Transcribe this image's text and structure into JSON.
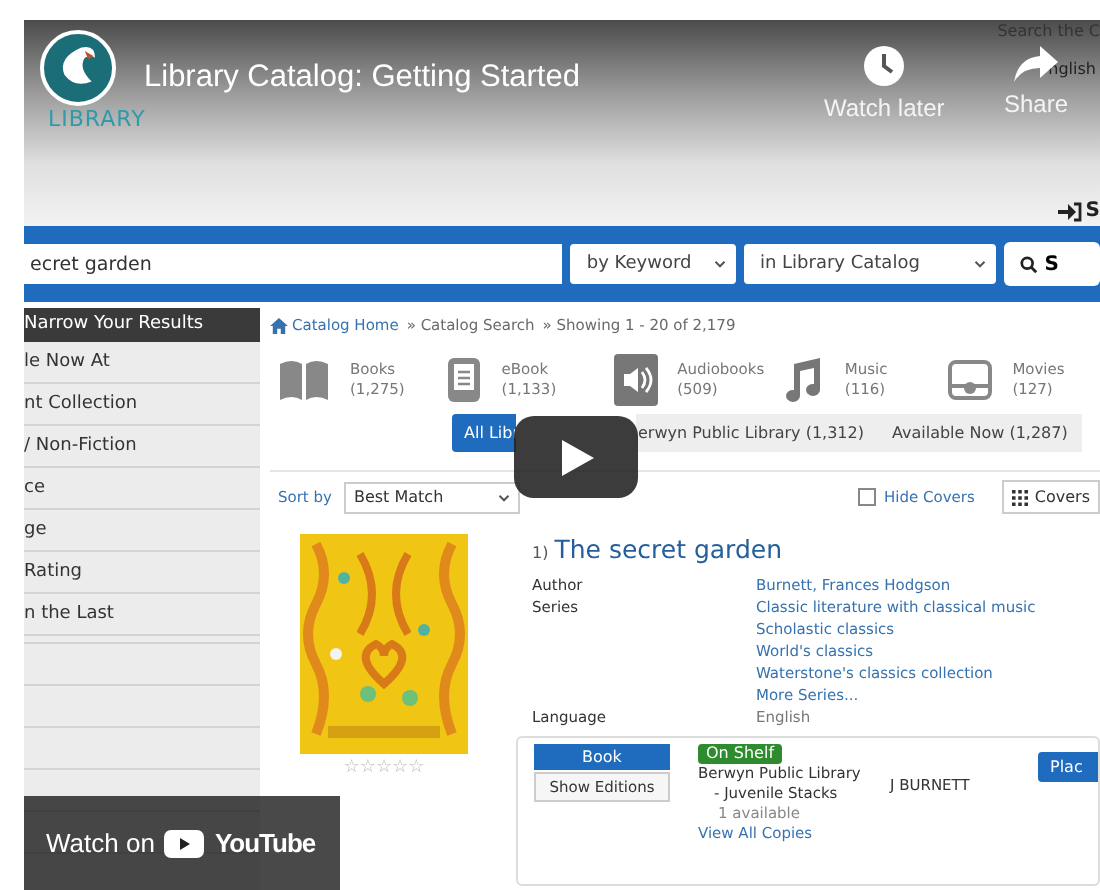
{
  "video": {
    "title": "Library Catalog: Getting Started",
    "actions": [
      {
        "kind": "clock",
        "label": "Watch later"
      },
      {
        "kind": "share",
        "label": "Share"
      }
    ],
    "watch_on": "Watch on",
    "brand": "YouTube"
  },
  "site": {
    "logo_text": "LIBRARY",
    "top_link": "Search the C",
    "language": "nglish",
    "sign_in": "S"
  },
  "search": {
    "value": "ecret garden",
    "type": "by Keyword",
    "scope": "in Library Catalog",
    "button": "S"
  },
  "sidebar": {
    "title": "Narrow Your Results",
    "items": [
      "le Now At",
      "nt Collection",
      "/ Non-Fiction",
      "ce",
      "ge",
      "Rating",
      "n the Last"
    ]
  },
  "breadcrumb": [
    "Catalog Home",
    "» Catalog Search",
    "» Showing 1 - 20 of 2,179"
  ],
  "formats": [
    {
      "kind": "book",
      "name": "Books",
      "count": "(1,275)"
    },
    {
      "kind": "ebook",
      "name": "eBook",
      "count": "(1,133)"
    },
    {
      "kind": "audio",
      "name": "Audiobooks",
      "count": "(509)"
    },
    {
      "kind": "music",
      "name": "Music",
      "count": "(116)"
    },
    {
      "kind": "movie",
      "name": "Movies",
      "count": "(127)"
    }
  ],
  "tabs": [
    {
      "label": "All Libr",
      "selected": true
    },
    {
      "label": "erwyn Public Library (1,312)",
      "selected": false
    },
    {
      "label": "Available Now (1,287)",
      "selected": false
    }
  ],
  "sort": {
    "label": "Sort by",
    "value": "Best Match"
  },
  "hide_covers": {
    "label": "Hide Covers",
    "checked": false
  },
  "view_button": "Covers",
  "result": {
    "number": "1)",
    "title": "The secret garden",
    "stars": 0,
    "details": [
      {
        "label": "Author",
        "link": true,
        "values": [
          "Burnett, Frances Hodgson"
        ]
      },
      {
        "label": "Series",
        "link": true,
        "values": [
          "Classic literature with classical music",
          "Scholastic classics",
          "World's classics",
          "Waterstone's classics collection",
          "More Series..."
        ]
      },
      {
        "label": "Language",
        "link": false,
        "values": [
          "English"
        ]
      }
    ],
    "holding": {
      "format": "Book",
      "editions": "Show Editions",
      "status": "On Shelf",
      "location": "Berwyn Public Library - Juvenile Stacks",
      "call_number": "J BURNETT",
      "availability": "1 available",
      "all_copies": "View All Copies",
      "action": "Plac"
    }
  }
}
